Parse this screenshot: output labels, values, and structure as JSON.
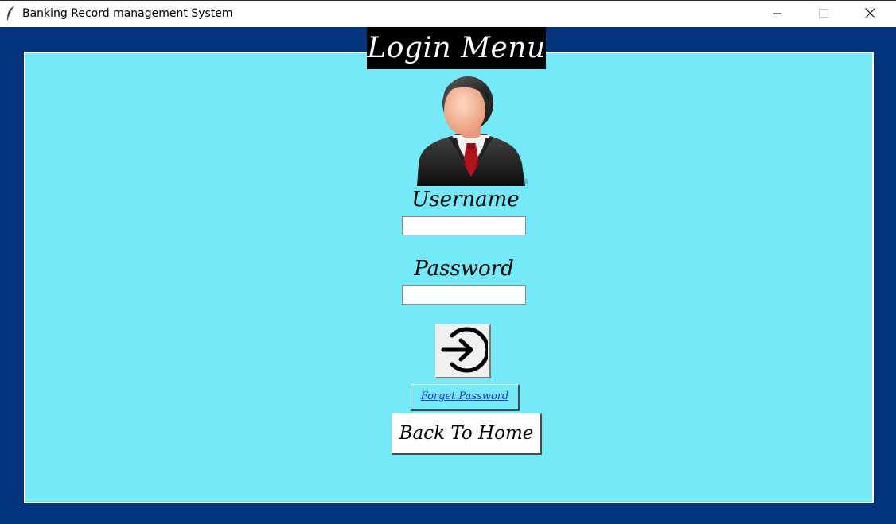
{
  "window": {
    "title": "Banking Record management System",
    "app_icon": "feather-icon",
    "controls": {
      "minimize_icon": "minimize-icon",
      "maximize_icon": "maximize-icon",
      "close_icon": "close-icon"
    }
  },
  "login": {
    "heading": "Login Menu",
    "avatar_icon": "businessman-avatar-icon",
    "username_label": "Username",
    "username_value": "",
    "password_label": "Password",
    "password_value": "",
    "submit_icon": "login-arrow-icon",
    "forget_password_label": "Forget Password",
    "back_home_label": "Back To Home"
  },
  "colors": {
    "frame": "#05347f",
    "panel": "#74e9f8",
    "heading_bg": "#000000",
    "heading_text": "#ffffff",
    "link": "#1a35e8"
  }
}
